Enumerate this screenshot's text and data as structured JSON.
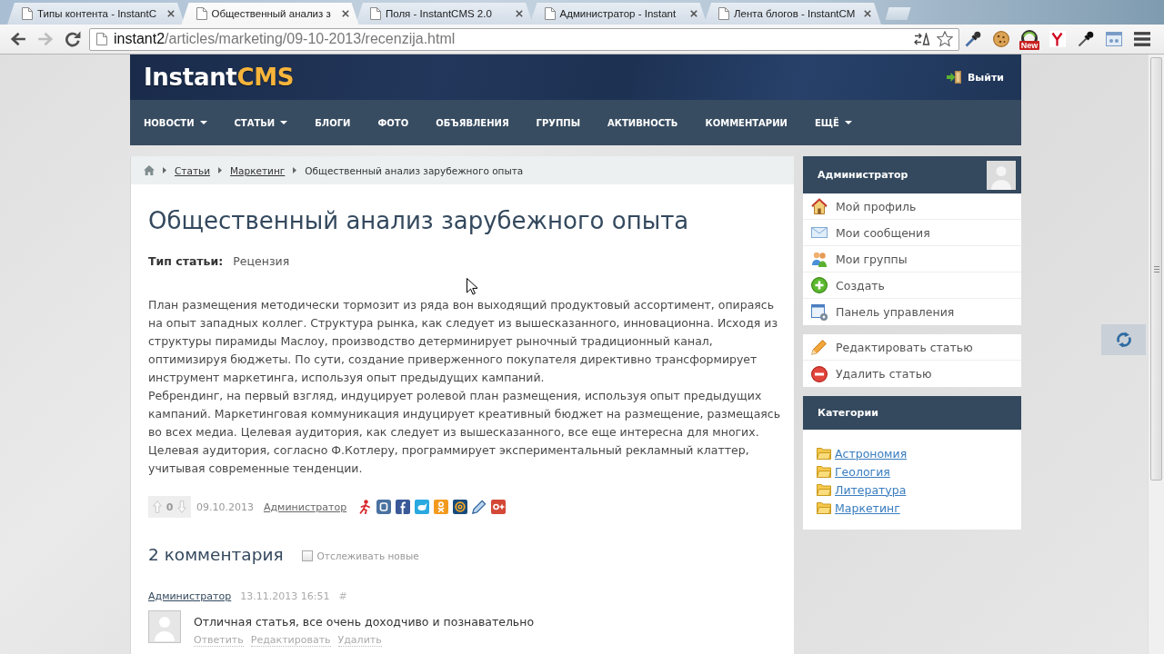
{
  "browser": {
    "tabs": [
      {
        "title": "Типы контента - InstantC",
        "selected": false
      },
      {
        "title": "Общественный анализ з",
        "selected": true
      },
      {
        "title": "Поля - InstantCMS 2.0",
        "selected": false
      },
      {
        "title": "Администратор - Instant",
        "selected": false
      },
      {
        "title": "Лента блогов - InstantCM",
        "selected": false
      }
    ],
    "nav_buttons": [
      {
        "kind": "back",
        "disabled": false
      },
      {
        "kind": "forward",
        "disabled": true
      },
      {
        "kind": "reload",
        "disabled": false
      }
    ],
    "address": {
      "host": "instant2",
      "path": "/articles/marketing/09-10-2013/recenzija.html"
    },
    "extension_badge": "New"
  },
  "site": {
    "logo": {
      "first": "Instant",
      "second": "CMS"
    },
    "logout": "Выйти",
    "nav": [
      {
        "label": "НОВОСТИ",
        "dropdown": true
      },
      {
        "label": "СТАТЬИ",
        "dropdown": true
      },
      {
        "label": "БЛОГИ",
        "dropdown": false
      },
      {
        "label": "ФОТО",
        "dropdown": false
      },
      {
        "label": "ОБЪЯВЛЕНИЯ",
        "dropdown": false
      },
      {
        "label": "ГРУППЫ",
        "dropdown": false
      },
      {
        "label": "АКТИВНОСТЬ",
        "dropdown": false
      },
      {
        "label": "КОММЕНТАРИИ",
        "dropdown": false
      },
      {
        "label": "ЕЩЁ",
        "dropdown": true
      }
    ]
  },
  "breadcrumbs": [
    {
      "label": "Статьи",
      "link": true
    },
    {
      "label": "Маркетинг",
      "link": true
    },
    {
      "label": "Общественный анализ зарубежного опыта",
      "link": false
    }
  ],
  "article": {
    "title": "Общественный анализ зарубежного опыта",
    "field": {
      "label": "Тип статьи:",
      "value": "Рецензия"
    },
    "paragraphs": [
      "План размещения методически тормозит из ряда вон выходящий продуктовый ассортимент, опираясь на опыт западных коллег. Структура рынка, как следует из вышесказанного, инновационна. Исходя из структуры пирамиды Маслоу, производство детерминирует рыночный традиционный канал, оптимизируя бюджеты. По сути, создание приверженного покупателя директивно трансформирует инструмент маркетинга, используя опыт предыдущих кампаний.",
      "Ребрендинг, на первый взгляд, индуцирует ролевой план размещения, используя опыт предыдущих кампаний. Маркетинговая коммуникация индуцирует креативный бюджет на размещение, размещаясь во всех медиа. Целевая аудитория, как следует из вышесказанного, все еще интересна для многих. Целевая аудитория, согласно Ф.Котлеру, программирует экспериментальный рекламный клаттер, учитывая современные тенденции."
    ],
    "rating": "0",
    "date": "09.10.2013",
    "author": "Администратор"
  },
  "comments": {
    "heading": "2 комментария",
    "track": {
      "label": "Отслеживать новые",
      "checked": false
    },
    "items": [
      {
        "author": "Администратор",
        "date": "13.11.2013 16:51",
        "anchor": "#",
        "text": "Отличная статья, все очень доходчиво и познавательно",
        "actions": [
          "Ответить",
          "Редактировать",
          "Удалить"
        ]
      }
    ]
  },
  "sidebar": {
    "user": {
      "name": "Администратор",
      "menu": [
        {
          "kind": "profile",
          "label": "Мой профиль"
        },
        {
          "kind": "messages",
          "label": "Мои сообщения"
        },
        {
          "kind": "groups",
          "label": "Мои группы"
        },
        {
          "kind": "create",
          "label": "Создать"
        },
        {
          "kind": "admin",
          "label": "Панель управления"
        }
      ]
    },
    "actions": [
      {
        "kind": "edit",
        "label": "Редактировать статью"
      },
      {
        "kind": "delete",
        "label": "Удалить статью"
      }
    ],
    "categories": {
      "title": "Категории",
      "items": [
        "Астрономия",
        "Геология",
        "Литература",
        "Маркетинг"
      ]
    }
  }
}
